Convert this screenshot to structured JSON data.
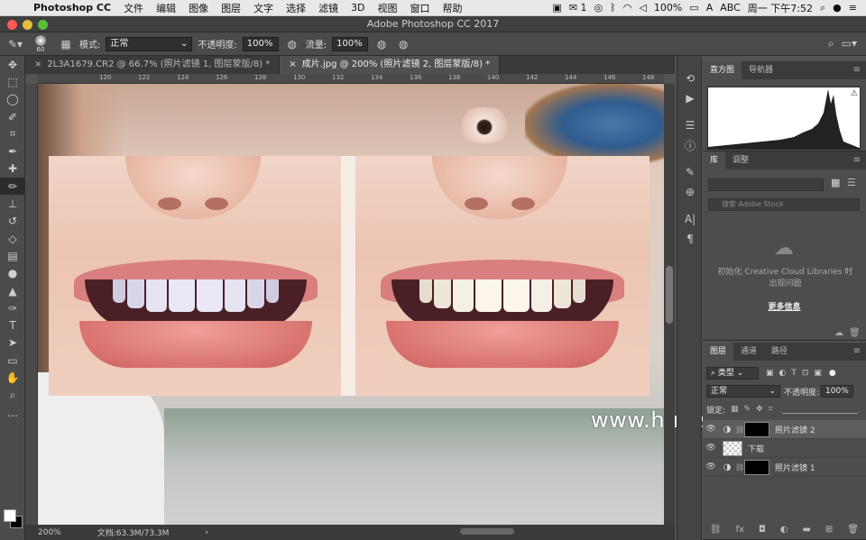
{
  "menubar": {
    "apple": "",
    "items": [
      "Photoshop CC",
      "文件",
      "编辑",
      "图像",
      "图层",
      "文字",
      "选择",
      "滤镜",
      "3D",
      "视图",
      "窗口",
      "帮助"
    ],
    "status": {
      "wechat_count": "1",
      "battery": "100%",
      "input_method": "ABC",
      "clock": "周一 下午7:52"
    }
  },
  "titlebar": {
    "title": "Adobe Photoshop CC 2017"
  },
  "options_bar": {
    "brush_size": "60",
    "mode_label": "模式:",
    "mode_value": "正常",
    "opacity_label": "不透明度:",
    "opacity_value": "100%",
    "flow_label": "流量:",
    "flow_value": "100%"
  },
  "doc_tabs": [
    {
      "label": "2L3A1679.CR2 @ 66.7% (照片滤镜 1, 图层蒙版/8) *"
    },
    {
      "label": "成片.jpg @ 200% (照片滤镜 2, 图层蒙版/8) *"
    }
  ],
  "ruler_ticks": [
    "120",
    "122",
    "124",
    "126",
    "128",
    "130",
    "132",
    "134",
    "136",
    "138",
    "140",
    "142",
    "144",
    "146",
    "148"
  ],
  "status_bar": {
    "zoom": "200%",
    "doc_size": "文档:63.3M/73.3M"
  },
  "watermark": "www.hunis.com",
  "panels": {
    "histogram_tabs": [
      "直方图",
      "导航器"
    ],
    "library_tabs": [
      "库",
      "调整"
    ],
    "library_search_placeholder": "搜索 Adobe Stock",
    "library_message": "初始化 Creative Cloud Libraries 时出现问题",
    "library_more": "更多信息",
    "layers_tabs": [
      "图层",
      "通道",
      "路径"
    ],
    "filter_kind": "类型",
    "blend_mode": "正常",
    "layer_opacity_label": "不透明度:",
    "layer_opacity_value": "100%",
    "lock_label": "锁定:",
    "layers": [
      {
        "name": "照片滤镜 2",
        "type": "adjustment",
        "active": true
      },
      {
        "name": "下载",
        "type": "pixel",
        "active": false
      },
      {
        "name": "照片滤镜 1",
        "type": "adjustment",
        "active": false
      }
    ]
  },
  "colors": {
    "teeth_before": "#e6e3f3",
    "teeth_after": "#f6efe6"
  }
}
